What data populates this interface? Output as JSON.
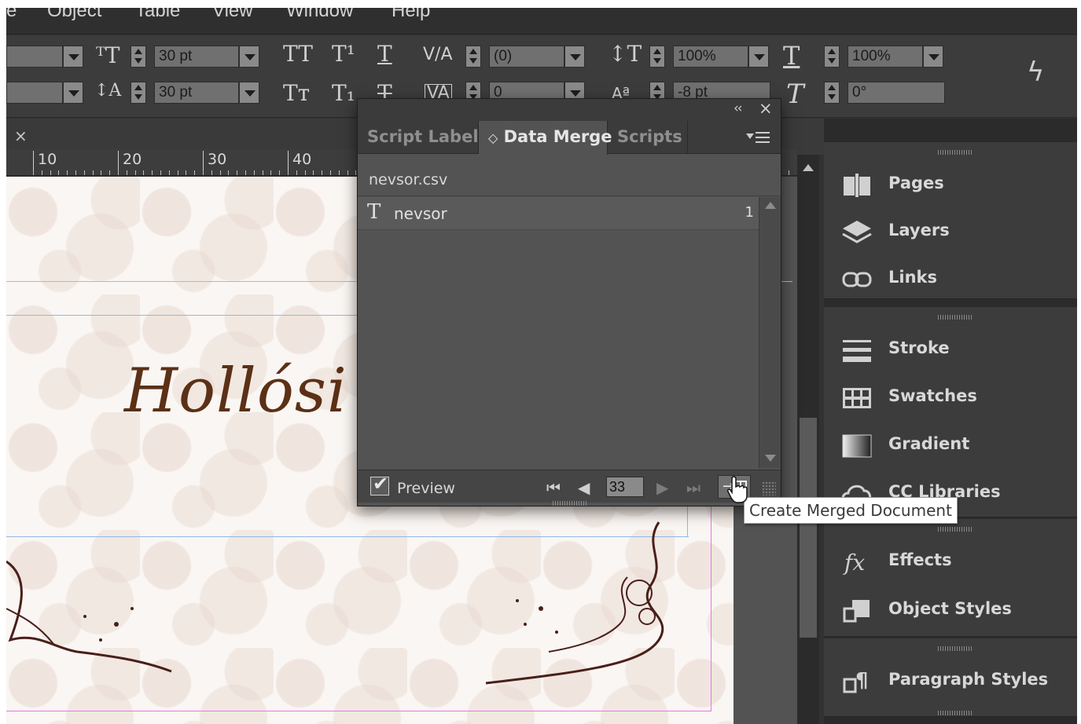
{
  "menu": {
    "items": [
      "e",
      "Object",
      "Table",
      "View",
      "Window",
      "Help"
    ]
  },
  "control_bar": {
    "font_size_value": "30 pt",
    "leading_value": "30 pt",
    "kerning_value": "(0)",
    "tracking_value": "0",
    "vertical_scale_value": "100%",
    "baseline_shift_value": "-8 pt",
    "horizontal_scale_value": "100%",
    "skew_value": "0°",
    "caps_label": "TT",
    "superscript_label": "T¹",
    "underline_label": "T",
    "small_caps_label": "Tт",
    "subscript_label": "T₁",
    "strike_label": "T",
    "kerning_icon": "V/A",
    "tracking_icon": "VA",
    "baseline_icon": "Aª"
  },
  "document": {
    "tab_close": "×",
    "ruler_labels": [
      "10",
      "20",
      "30",
      "40"
    ],
    "page_text": "Hollósi"
  },
  "data_merge_panel": {
    "tabs": [
      {
        "label": "Script Label",
        "active": false
      },
      {
        "label": "Data Merge",
        "active": true
      },
      {
        "label": "Scripts",
        "active": false
      }
    ],
    "active_tab_prefix": "◇",
    "source_file": "nevsor.csv",
    "fields": [
      {
        "icon": "T",
        "name": "nevsor",
        "count": "1"
      }
    ],
    "preview_label": "Preview",
    "preview_checked": true,
    "record_number": "33",
    "nav": {
      "first": "⏮",
      "prev": "◀",
      "next": "▶",
      "last": "⏭"
    },
    "collapse_glyph": "‹‹",
    "close_glyph": "×"
  },
  "tooltip": {
    "text": "Create Merged Document"
  },
  "dock": {
    "items": [
      {
        "label": "Pages",
        "icon": "pages-icon"
      },
      {
        "label": "Layers",
        "icon": "layers-icon"
      },
      {
        "label": "Links",
        "icon": "links-icon"
      },
      {
        "label": "Stroke",
        "icon": "stroke-icon"
      },
      {
        "label": "Swatches",
        "icon": "swatches-icon"
      },
      {
        "label": "Gradient",
        "icon": "gradient-icon"
      },
      {
        "label": "CC Libraries",
        "icon": "cc-libraries-icon"
      },
      {
        "label": "Effects",
        "icon": "effects-icon"
      },
      {
        "label": "Object Styles",
        "icon": "object-styles-icon"
      },
      {
        "label": "Paragraph Styles",
        "icon": "paragraph-styles-icon"
      }
    ]
  },
  "colors": {
    "ui_dark": "#323232",
    "panel": "#535353",
    "page_text": "#5b3016",
    "guide_cyan": "#6fd3e0",
    "guide_blue": "#8fb8e8",
    "guide_magenta": "#e07be0"
  }
}
